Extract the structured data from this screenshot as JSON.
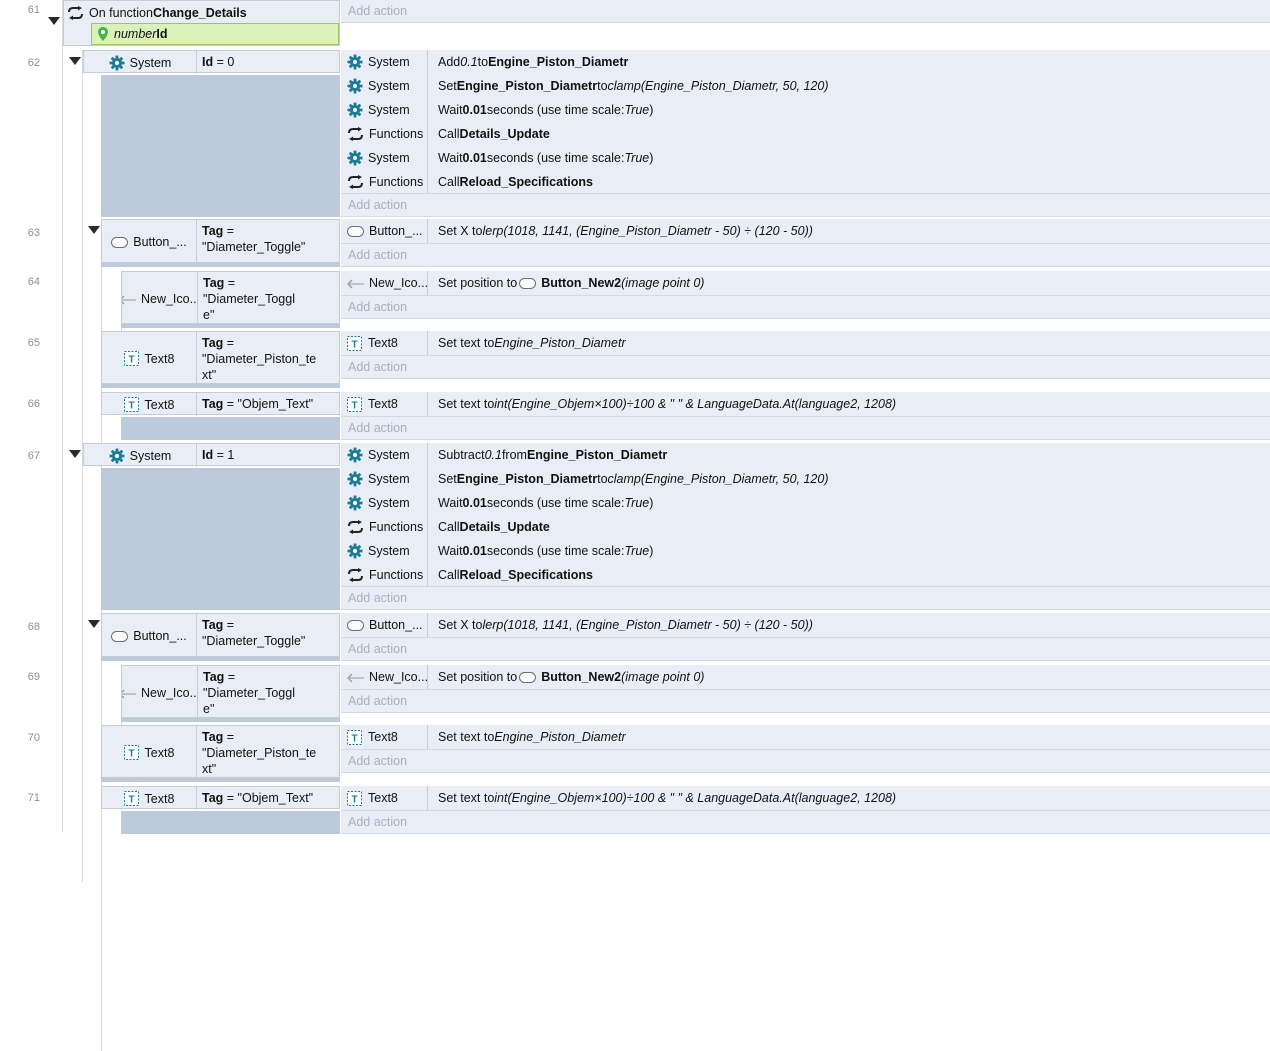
{
  "function_block": {
    "line": "61",
    "prefix": "On function",
    "name": "Change_Details",
    "param_type": "number",
    "param_name": "Id",
    "add_action": "Add action"
  },
  "events": [
    {
      "line": "62",
      "object": "System",
      "condition_label": "Id",
      "condition_value": " = 0",
      "actions": [
        {
          "object": "System",
          "parts": [
            [
              "n",
              "Add "
            ],
            [
              "i",
              "0.1"
            ],
            [
              "n",
              " to "
            ],
            [
              "b",
              "Engine_Piston_Diametr"
            ]
          ]
        },
        {
          "object": "System",
          "parts": [
            [
              "n",
              "Set "
            ],
            [
              "b",
              "Engine_Piston_Diametr"
            ],
            [
              "n",
              " to "
            ],
            [
              "i",
              "clamp(Engine_Piston_Diametr, 50, 120)"
            ]
          ]
        },
        {
          "object": "System",
          "parts": [
            [
              "n",
              "Wait "
            ],
            [
              "b",
              "0.01"
            ],
            [
              "n",
              " seconds (use time scale: "
            ],
            [
              "i",
              "True"
            ],
            [
              "n",
              ")"
            ]
          ]
        },
        {
          "object": "Functions",
          "parts": [
            [
              "n",
              "Call "
            ],
            [
              "b",
              "Details_Update"
            ]
          ]
        },
        {
          "object": "System",
          "parts": [
            [
              "n",
              "Wait "
            ],
            [
              "b",
              "0.01"
            ],
            [
              "n",
              " seconds (use time scale: "
            ],
            [
              "i",
              "True"
            ],
            [
              "n",
              ")"
            ]
          ]
        },
        {
          "object": "Functions",
          "parts": [
            [
              "n",
              "Call "
            ],
            [
              "b",
              "Reload_Specifications"
            ]
          ]
        }
      ],
      "add_action": "Add action"
    },
    {
      "line": "63",
      "object": "Button_...",
      "condition_label": "Tag",
      "condition_value": " =\n\"Diameter_Toggle\"",
      "actions": [
        {
          "object": "Button_...",
          "parts": [
            [
              "n",
              "Set X to "
            ],
            [
              "i",
              "lerp(1018, 1141, (Engine_Piston_Diametr - 50) ÷ (120 - 50))"
            ]
          ]
        }
      ],
      "add_action": "Add action"
    },
    {
      "line": "64",
      "object": "New_Ico...",
      "condition_label": "Tag",
      "condition_value": " =\n\"Diameter_Toggl\ne\"",
      "actions": [
        {
          "object": "New_Ico...",
          "parts": [
            [
              "n",
              "Set position to "
            ],
            [
              "btn",
              ""
            ],
            [
              "b",
              "Button_New2"
            ],
            [
              "n",
              " "
            ],
            [
              "i",
              "(image point 0)"
            ]
          ]
        }
      ],
      "add_action": "Add action"
    },
    {
      "line": "65",
      "object": "Text8",
      "condition_label": "Tag",
      "condition_value": " =\n\"Diameter_Piston_te\nxt\"",
      "actions": [
        {
          "object": "Text8",
          "parts": [
            [
              "n",
              "Set text to "
            ],
            [
              "i",
              "Engine_Piston_Diametr"
            ]
          ]
        }
      ],
      "add_action": "Add action"
    },
    {
      "line": "66",
      "object": "Text8",
      "condition_label": "Tag",
      "condition_value": " = \"Objem_Text\"",
      "actions": [
        {
          "object": "Text8",
          "parts": [
            [
              "n",
              "Set text to "
            ],
            [
              "i",
              "int(Engine_Objem×100)÷100 & \" \" & LanguageData.At(language2, 1208)"
            ]
          ]
        }
      ],
      "add_action": "Add action"
    },
    {
      "line": "67",
      "object": "System",
      "condition_label": "Id",
      "condition_value": " = 1",
      "actions": [
        {
          "object": "System",
          "parts": [
            [
              "n",
              "Subtract "
            ],
            [
              "i",
              "0.1"
            ],
            [
              "n",
              " from "
            ],
            [
              "b",
              "Engine_Piston_Diametr"
            ]
          ]
        },
        {
          "object": "System",
          "parts": [
            [
              "n",
              "Set "
            ],
            [
              "b",
              "Engine_Piston_Diametr"
            ],
            [
              "n",
              " to "
            ],
            [
              "i",
              "clamp(Engine_Piston_Diametr, 50, 120)"
            ]
          ]
        },
        {
          "object": "System",
          "parts": [
            [
              "n",
              "Wait "
            ],
            [
              "b",
              "0.01"
            ],
            [
              "n",
              " seconds (use time scale: "
            ],
            [
              "i",
              "True"
            ],
            [
              "n",
              ")"
            ]
          ]
        },
        {
          "object": "Functions",
          "parts": [
            [
              "n",
              "Call "
            ],
            [
              "b",
              "Details_Update"
            ]
          ]
        },
        {
          "object": "System",
          "parts": [
            [
              "n",
              "Wait "
            ],
            [
              "b",
              "0.01"
            ],
            [
              "n",
              " seconds (use time scale: "
            ],
            [
              "i",
              "True"
            ],
            [
              "n",
              ")"
            ]
          ]
        },
        {
          "object": "Functions",
          "parts": [
            [
              "n",
              "Call "
            ],
            [
              "b",
              "Reload_Specifications"
            ]
          ]
        }
      ],
      "add_action": "Add action"
    },
    {
      "line": "68",
      "object": "Button_...",
      "condition_label": "Tag",
      "condition_value": " =\n\"Diameter_Toggle\"",
      "actions": [
        {
          "object": "Button_...",
          "parts": [
            [
              "n",
              "Set X to "
            ],
            [
              "i",
              "lerp(1018, 1141, (Engine_Piston_Diametr - 50) ÷ (120 - 50))"
            ]
          ]
        }
      ],
      "add_action": "Add action"
    },
    {
      "line": "69",
      "object": "New_Ico...",
      "condition_label": "Tag",
      "condition_value": " =\n\"Diameter_Toggl\ne\"",
      "actions": [
        {
          "object": "New_Ico...",
          "parts": [
            [
              "n",
              "Set position to "
            ],
            [
              "btn",
              ""
            ],
            [
              "b",
              "Button_New2"
            ],
            [
              "n",
              " "
            ],
            [
              "i",
              "(image point 0)"
            ]
          ]
        }
      ],
      "add_action": "Add action"
    },
    {
      "line": "70",
      "object": "Text8",
      "condition_label": "Tag",
      "condition_value": " =\n\"Diameter_Piston_te\nxt\"",
      "actions": [
        {
          "object": "Text8",
          "parts": [
            [
              "n",
              "Set text to "
            ],
            [
              "i",
              "Engine_Piston_Diametr"
            ]
          ]
        }
      ],
      "add_action": "Add action"
    },
    {
      "line": "71",
      "object": "Text8",
      "condition_label": "Tag",
      "condition_value": " = \"Objem_Text\"",
      "actions": [
        {
          "object": "Text8",
          "parts": [
            [
              "n",
              "Set text to "
            ],
            [
              "i",
              "int(Engine_Objem×100)÷100 & \" \" & LanguageData.At(language2, 1208)"
            ]
          ]
        }
      ],
      "add_action": "Add action"
    }
  ],
  "icons": {
    "System": "gear-icon",
    "Functions": "function-loop-icon",
    "Button_...": "button-object-icon",
    "New_Ico...": "arrow-object-icon",
    "Text8": "text-object-icon"
  },
  "colors": {
    "event_bg": "#e9eef6",
    "subevent_gray": "#bdcadb",
    "param_green": "#daf2b9",
    "gear_teal": "#1c7a99",
    "add_action_text": "#a7b0be",
    "line_number": "#8a8f98"
  }
}
